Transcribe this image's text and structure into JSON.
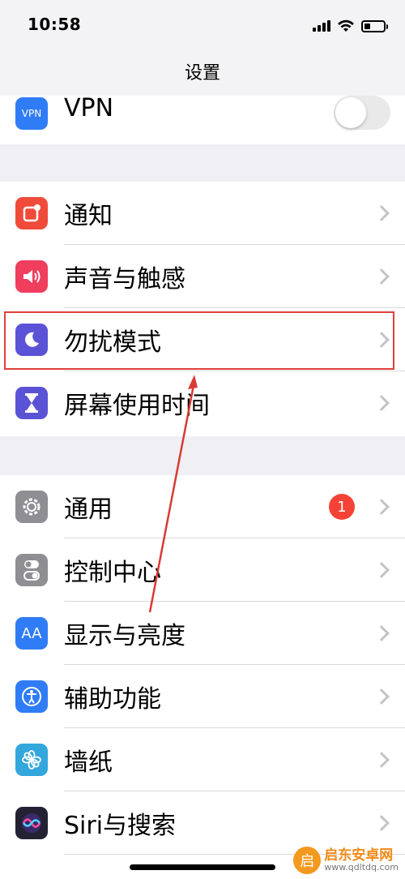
{
  "status_bar": {
    "time": "10:58"
  },
  "nav": {
    "title": "设置"
  },
  "vpn": {
    "label": "VPN",
    "icon_text": "VPN",
    "toggle_on": false
  },
  "group1": [
    {
      "id": "notifications",
      "label": "通知",
      "icon": "notification-icon",
      "color": "#f04b3a"
    },
    {
      "id": "sounds",
      "label": "声音与触感",
      "icon": "speaker-icon",
      "color": "#ef3e5e"
    },
    {
      "id": "dnd",
      "label": "勿扰模式",
      "icon": "moon-icon",
      "color": "#5b53d6"
    },
    {
      "id": "screen-time",
      "label": "屏幕使用时间",
      "icon": "hourglass-icon",
      "color": "#5b53d6"
    }
  ],
  "group2": [
    {
      "id": "general",
      "label": "通用",
      "icon": "gear-icon",
      "color": "#8e8e93",
      "badge": "1"
    },
    {
      "id": "control-center",
      "label": "控制中心",
      "icon": "switches-icon",
      "color": "#8e8e93"
    },
    {
      "id": "display",
      "label": "显示与亮度",
      "icon": "aa-icon",
      "color": "#2f7cf6",
      "icon_text": "AA"
    },
    {
      "id": "accessibility",
      "label": "辅助功能",
      "icon": "accessibility-icon",
      "color": "#2f7cf6"
    },
    {
      "id": "wallpaper",
      "label": "墙纸",
      "icon": "flower-icon",
      "color": "#33a6dc"
    },
    {
      "id": "siri",
      "label": "Siri与搜索",
      "icon": "siri-icon",
      "color": "#222233"
    }
  ],
  "watermark": {
    "name": "启东安卓网",
    "url": "www.qdltdq.com",
    "logo_text": "启"
  },
  "colors": {
    "highlight": "#e0403a",
    "badge": "#f44336"
  }
}
